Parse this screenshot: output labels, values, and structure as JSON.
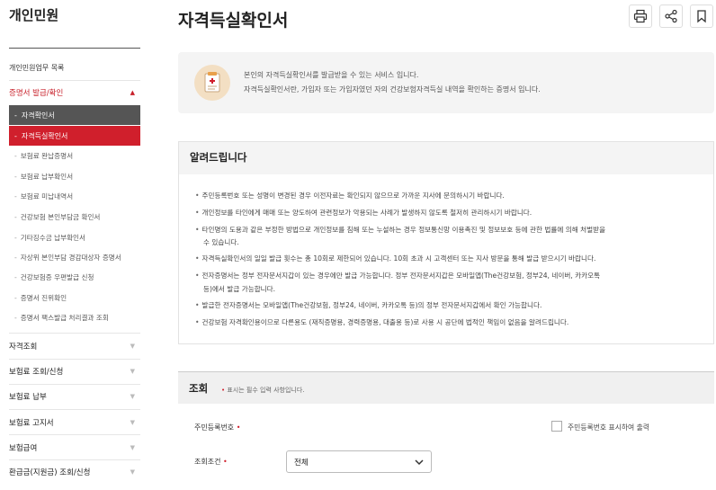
{
  "sidebar": {
    "title": "개인민원",
    "link": "개인민원업무 목록",
    "active_category": "증명서 발급/확인",
    "sub_active_1": "자격확인서",
    "sub_active_2": "자격득실확인서",
    "sub_items": [
      "보험료 완납증명서",
      "보험료 납부확인서",
      "보험료 미납내역서",
      "건강보험 본인부담금 확인서",
      "기타징수금 납부확인서",
      "자상위 본인부담 경감대상자 증명서",
      "건강보험증 우편발급 신청",
      "증명서 진위확인",
      "증명서 팩스발급 처리결과 조회"
    ],
    "categories": [
      "자격조회",
      "보험료 조회/신청",
      "보험료 납부",
      "보험료 고지서",
      "보험급여",
      "환급금(지원금) 조회/신청"
    ]
  },
  "header": {
    "title": "자격득실확인서",
    "icons": [
      "print-icon",
      "share-icon",
      "bookmark-icon"
    ]
  },
  "intro": {
    "icon": "document-icon",
    "line1": "본인의 자격득실확인서를 발급받을 수 있는 서비스 입니다.",
    "line2": "자격득실확인서란, 가입자 또는 가입자였던 자의 건강보험자격득실 내역을 확인하는 증명서 입니다."
  },
  "notice": {
    "title": "알려드립니다",
    "items": [
      "주민등록번호 또는 성명이 변경된 경우 이전자료는 확인되지 않으므로 가까운 지사에 문의하시기 바랍니다.",
      "개인정보를 타인에게 매매 또는 양도하여 관련정보가 악용되는 사례가 발생하지 않도록 철저히 관리하시기 바랍니다.",
      "타인명의 도용과 같은 부정한 방법으로 개인정보를 침해 또는 누설하는 경우 정보통신망 이용촉진 및 정보보호 등에 관한 법률에 의해 처벌받을",
      "수 있습니다.",
      "자격득실확인서의 일일 발급 횟수는 총 10회로 제한되어 있습니다. 10회 초과 시 고객센터 또는 지사 방문을 통해 발급 받으시기 바랍니다.",
      "전자증명서는 정부 전자문서지갑이 있는 경우에만 발급 가능합니다. 정부 전자문서지갑은 모바일앱(The건강보험, 정부24, 네이버, 카카오톡",
      "등)에서 발급 가능합니다.",
      "발급한 전자증명서는 모바일앱(The건강보험, 정부24, 네이버, 카카오톡 등)의 정부 전자문서지갑에서 확인 가능합니다.",
      "건강보험 자격확인용이므로 다른용도 (재직증명용, 경력증명용, 대출용 등)로 사용 시 공단에 법적인 책임이 없음을 알려드립니다."
    ]
  },
  "query": {
    "title": "조회",
    "required_note": "표시는 필수 입력 사항입니다.",
    "field1_label": "주민등록번호",
    "checkbox_label": "주민등록번호 표시하여 출력",
    "field2_label": "조회조건",
    "select_value": "전체"
  },
  "colors": {
    "accent_red": "#d01f2c",
    "active_dark": "#555555"
  }
}
